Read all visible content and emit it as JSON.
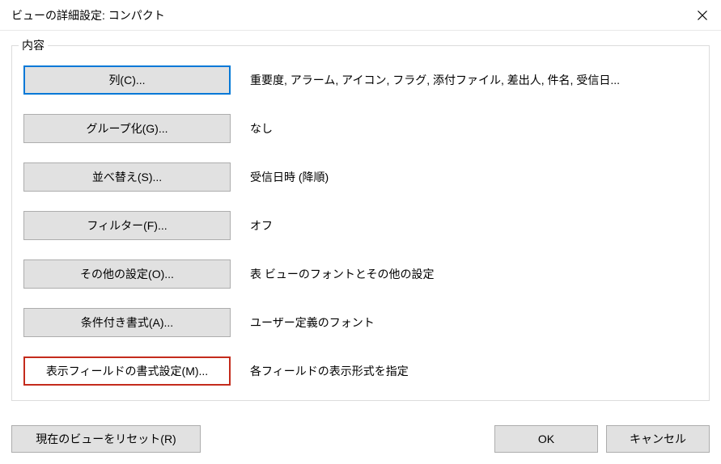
{
  "titlebar": {
    "title": "ビューの詳細設定: コンパクト"
  },
  "groupbox": {
    "legend": "内容"
  },
  "rows": {
    "columns": {
      "button_label": "列(C)...",
      "desc": "重要度, アラーム, アイコン, フラグ, 添付ファイル, 差出人, 件名, 受信日..."
    },
    "groupby": {
      "button_label": "グループ化(G)...",
      "desc": "なし"
    },
    "sort": {
      "button_label": "並べ替え(S)...",
      "desc": "受信日時 (降順)"
    },
    "filter": {
      "button_label": "フィルター(F)...",
      "desc": "オフ"
    },
    "other_settings": {
      "button_label": "その他の設定(O)...",
      "desc": "表 ビューのフォントとその他の設定"
    },
    "conditional_format": {
      "button_label": "条件付き書式(A)...",
      "desc": "ユーザー定義のフォント"
    },
    "field_format": {
      "button_label": "表示フィールドの書式設定(M)...",
      "desc": "各フィールドの表示形式を指定"
    }
  },
  "footer": {
    "reset_label": "現在のビューをリセット(R)",
    "ok_label": "OK",
    "cancel_label": "キャンセル"
  }
}
